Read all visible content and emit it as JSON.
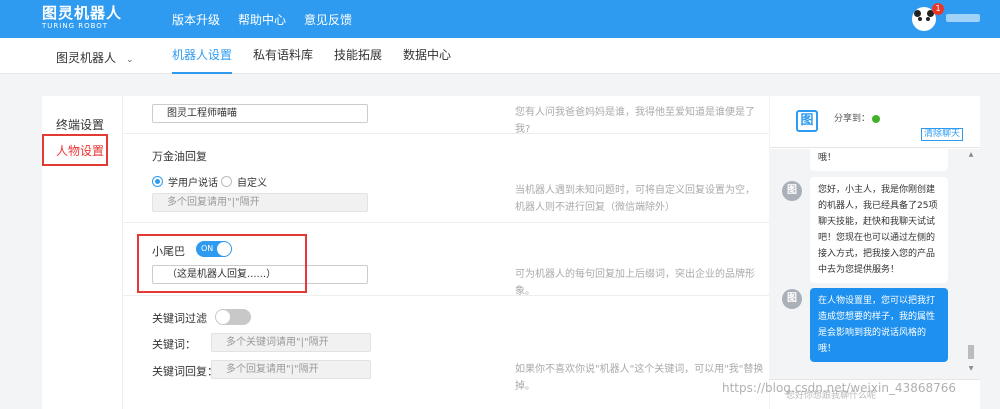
{
  "topbar": {
    "logo_cn": "图灵机器人",
    "logo_en": "TURING ROBOT",
    "nav": [
      "版本升级",
      "帮助中心",
      "意见反馈"
    ],
    "notification_count": "1",
    "brand_color": "#2f9bf0"
  },
  "subnav": {
    "robot_name": "图灵机器人",
    "tabs": [
      "机器人设置",
      "私有语料库",
      "技能拓展",
      "数据中心"
    ],
    "active_tab": "机器人设置"
  },
  "side_menu": {
    "items": [
      "终端设置",
      "人物设置"
    ],
    "active": "人物设置"
  },
  "settings": {
    "top_input": {
      "value": "图灵工程师喵喵"
    },
    "top_hint": "您有人问我爸爸妈妈是谁，我得他至爱知道是谁便是了我?",
    "fallback": {
      "label": "万金油回复",
      "radio_options": [
        "学用户说话",
        "自定义"
      ],
      "selected": "学用户说话",
      "placeholder": "多个回复请用\"|\"隔开",
      "hint_line1": "当机器人遇到未知问题时，可将自定义回复设置为空，",
      "hint_line2": "机器人则不进行回复（微信端除外）"
    },
    "tail": {
      "label": "小尾巴",
      "toggle": "ON",
      "enabled": true,
      "value": "（这是机器人回复......）",
      "hint": "可为机器人的每句回复加上后缀词，突出企业的品牌形象。"
    },
    "keyword_filter": {
      "label": "关键词过滤",
      "enabled": false,
      "keywords_label": "关键词：",
      "keywords_placeholder": "多个关键词请用\"|\"隔开",
      "reply_label": "关键词回复：",
      "reply_placeholder": "多个回复请用\"|\"隔开",
      "hint": "如果你不喜欢你说\"机器人\"这个关键词，可以用\"我\"替换掉。"
    }
  },
  "chat": {
    "logo": "图",
    "share_label": "分享到：",
    "clear_label": "清除聊天",
    "messages": [
      {
        "from": "bot",
        "text": "哦！"
      },
      {
        "from": "bot",
        "text": "您好，小主人，我是你刚创建的机器人，我已经具备了25项聊天技能，赶快和我聊天试试吧！您现在也可以通过左侧的接入方式，把我接入您的产品中去为您提供服务！"
      },
      {
        "from": "bot",
        "text": "在人物设置里，您可以把我打造成您想要的样子，我的属性是会影响到我的说话风格的哦！"
      }
    ],
    "input_placeholder": "您好你想跟我聊什么呢"
  },
  "watermark": "https://blog.csdn.net/weixin_43868766"
}
